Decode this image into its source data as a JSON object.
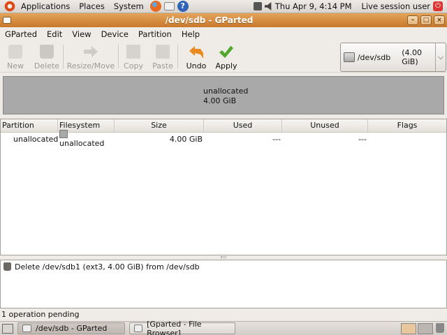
{
  "top_panel": {
    "menus": [
      "Applications",
      "Places",
      "System"
    ],
    "clock": "Thu Apr  9,  4:14 PM",
    "session": "Live session user"
  },
  "window": {
    "title": "/dev/sdb - GParted"
  },
  "menubar": [
    "GParted",
    "Edit",
    "View",
    "Device",
    "Partition",
    "Help"
  ],
  "toolbar": {
    "new": "New",
    "delete": "Delete",
    "resize_move": "Resize/Move",
    "copy": "Copy",
    "paste": "Paste",
    "undo": "Undo",
    "apply": "Apply"
  },
  "device": {
    "name": "/dev/sdb",
    "size": "(4.00 GiB)"
  },
  "disk_visual": {
    "label": "unallocated",
    "size": "4.00 GiB",
    "color": "#a9a9a9"
  },
  "table": {
    "columns": [
      "Partition",
      "Filesystem",
      "Size",
      "Used",
      "Unused",
      "Flags"
    ],
    "rows": [
      {
        "partition": "unallocated",
        "filesystem": "unallocated",
        "size": "4.00 GiB",
        "used": "---",
        "unused": "---",
        "flags": ""
      }
    ]
  },
  "operations": [
    "Delete /dev/sdb1 (ext3, 4.00 GiB) from /dev/sdb"
  ],
  "status": "1 operation pending",
  "taskbar": {
    "tasks": [
      "/dev/sdb - GParted",
      "[Gparted - File Browser]"
    ]
  }
}
